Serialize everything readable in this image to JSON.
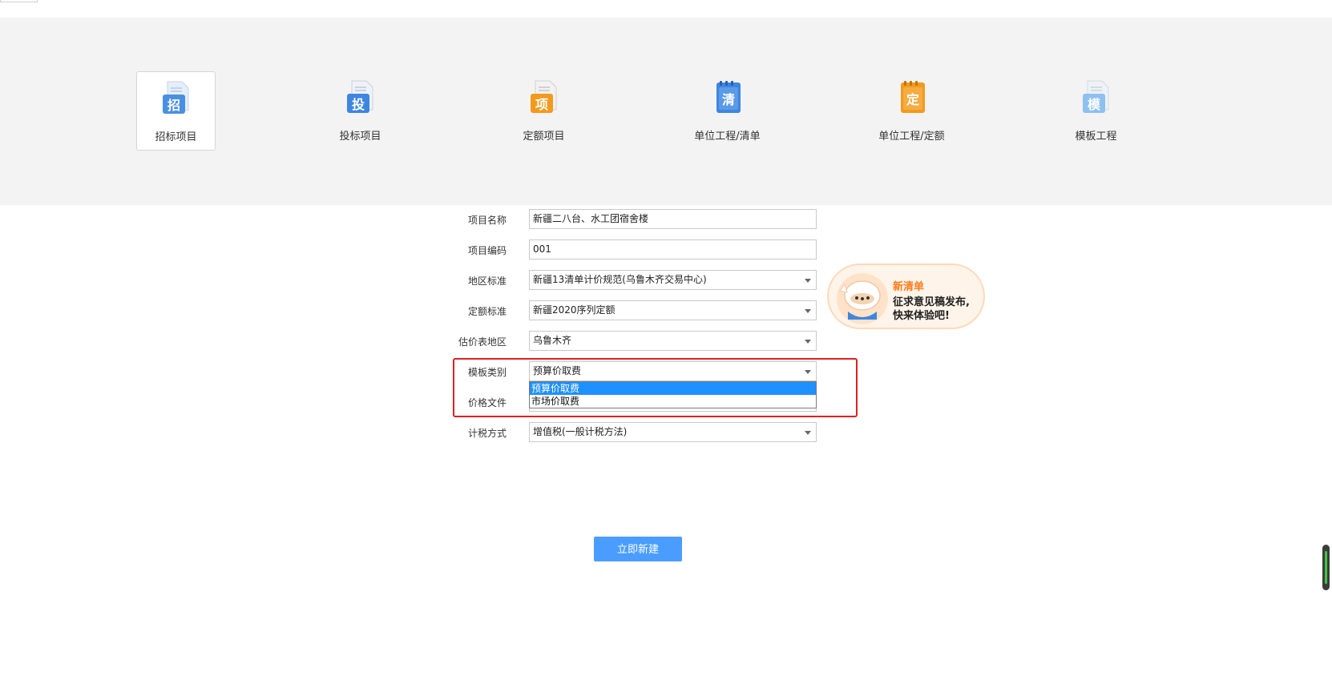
{
  "tiles": [
    {
      "label": "招标项目",
      "glyph": "招",
      "color": "#4a90e2",
      "active": true
    },
    {
      "label": "投标项目",
      "glyph": "投",
      "color": "#3d86e0",
      "active": false
    },
    {
      "label": "定额项目",
      "glyph": "项",
      "color": "#f39a1d",
      "active": false
    },
    {
      "label": "单位工程/清单",
      "glyph": "清",
      "color": "#3d86e0",
      "active": false
    },
    {
      "label": "单位工程/定额",
      "glyph": "定",
      "color": "#f39a1d",
      "active": false
    },
    {
      "label": "模板工程",
      "glyph": "模",
      "color": "#8ec0f0",
      "active": false
    }
  ],
  "form": {
    "project_name": {
      "label": "项目名称",
      "value": "新疆二八台、水工团宿舍楼"
    },
    "project_code": {
      "label": "项目编码",
      "value": "001"
    },
    "region_standard": {
      "label": "地区标准",
      "value": "新疆13清单计价规范(乌鲁木齐交易中心)"
    },
    "quota_standard": {
      "label": "定额标准",
      "value": "新疆2020序列定额"
    },
    "price_region": {
      "label": "估价表地区",
      "value": "乌鲁木齐"
    },
    "template_type": {
      "label": "模板类别",
      "value": "预算价取费"
    },
    "price_file": {
      "label": "价格文件",
      "value": ""
    },
    "tax_method": {
      "label": "计税方式",
      "value": "增值税(一般计税方法)"
    }
  },
  "dropdown": {
    "options": [
      "预算价取费",
      "市场价取费"
    ],
    "selected_index": 0
  },
  "promo": {
    "title": "新清单",
    "line1": "征求意见稿发布,",
    "line2": "快来体验吧!"
  },
  "create_button": {
    "label": "立即新建"
  },
  "colors": {
    "primary": "#4a9dff",
    "highlight": "#e02020",
    "selected": "#1e90ff"
  }
}
